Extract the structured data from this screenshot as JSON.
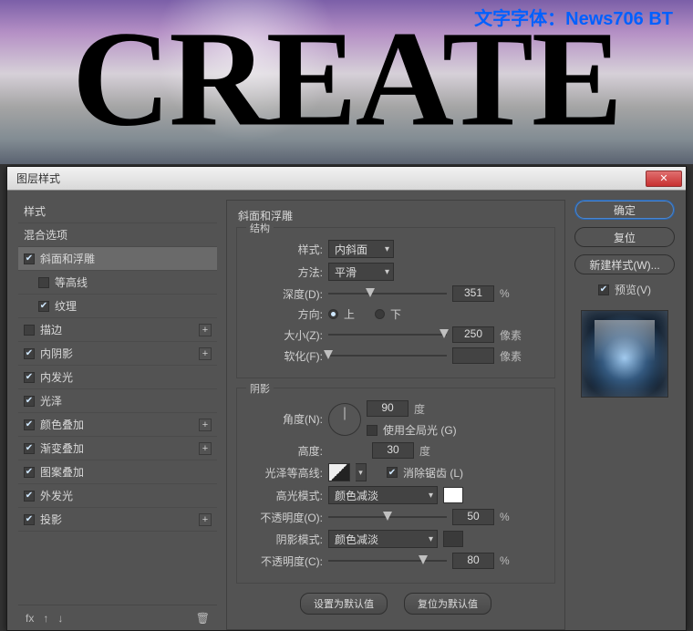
{
  "banner": {
    "font_label": "文字字体：News706 BT",
    "text": "CREATE"
  },
  "dialog": {
    "title": "图层样式"
  },
  "sidebar": {
    "styles_label": "样式",
    "blend_options_label": "混合选项",
    "items": [
      {
        "label": "斜面和浮雕",
        "checked": true,
        "selected": true,
        "expandable": false
      },
      {
        "label": "等高线",
        "checked": false,
        "sub": true
      },
      {
        "label": "纹理",
        "checked": true,
        "sub": true
      },
      {
        "label": "描边",
        "checked": false,
        "expandable": true
      },
      {
        "label": "内阴影",
        "checked": true,
        "expandable": true
      },
      {
        "label": "内发光",
        "checked": true
      },
      {
        "label": "光泽",
        "checked": true
      },
      {
        "label": "颜色叠加",
        "checked": true,
        "expandable": true
      },
      {
        "label": "渐变叠加",
        "checked": true,
        "expandable": true
      },
      {
        "label": "图案叠加",
        "checked": true
      },
      {
        "label": "外发光",
        "checked": true
      },
      {
        "label": "投影",
        "checked": true,
        "expandable": true
      }
    ],
    "fx_label": "fx"
  },
  "panel": {
    "title": "斜面和浮雕",
    "structure": {
      "legend": "结构",
      "style_label": "样式:",
      "style_value": "内斜面",
      "technique_label": "方法:",
      "technique_value": "平滑",
      "depth_label": "深度(D):",
      "depth_value": "351",
      "depth_unit": "%",
      "direction_label": "方向:",
      "up_label": "上",
      "down_label": "下",
      "direction": "up",
      "size_label": "大小(Z):",
      "size_value": "250",
      "size_unit": "像素",
      "soften_label": "软化(F):",
      "soften_value": "",
      "soften_unit": "像素"
    },
    "shading": {
      "legend": "阴影",
      "angle_label": "角度(N):",
      "angle_value": "90",
      "angle_unit": "度",
      "global_light_label": "使用全局光 (G)",
      "global_light": false,
      "altitude_label": "高度:",
      "altitude_value": "30",
      "altitude_unit": "度",
      "gloss_contour_label": "光泽等高线:",
      "antialias_label": "消除锯齿 (L)",
      "antialias": true,
      "highlight_mode_label": "高光模式:",
      "highlight_mode_value": "颜色减淡",
      "highlight_color": "#ffffff",
      "highlight_opacity_label": "不透明度(O):",
      "highlight_opacity_value": "50",
      "opacity_unit": "%",
      "shadow_mode_label": "阴影模式:",
      "shadow_mode_value": "颜色减淡",
      "shadow_color": "#3a3a3a",
      "shadow_opacity_label": "不透明度(C):",
      "shadow_opacity_value": "80"
    },
    "buttons": {
      "make_default": "设置为默认值",
      "reset_default": "复位为默认值"
    }
  },
  "right": {
    "ok": "确定",
    "cancel": "复位",
    "new_style": "新建样式(W)...",
    "preview_label": "预览(V)"
  }
}
